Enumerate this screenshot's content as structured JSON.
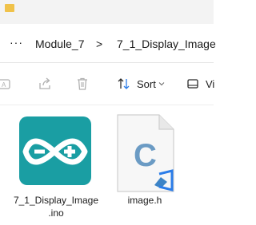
{
  "breadcrumb": {
    "overflow_label": "···",
    "segments": [
      "Module_7",
      "7_1_Display_Image"
    ],
    "separator": ">"
  },
  "toolbar": {
    "rename_icon": "rename-icon",
    "share_icon": "share-icon",
    "delete_icon": "trash-icon",
    "sort_label": "Sort",
    "view_label": "Vi"
  },
  "files": [
    {
      "name_line1": "7_1_Display_Image",
      "name_line2": ".ino",
      "icon": "arduino-icon",
      "color": "#1a9ea3"
    },
    {
      "name_line1": "image.h",
      "icon": "c-header-file-icon",
      "color": "#3d84c6"
    }
  ],
  "colors": {
    "accent": "#2b7de9",
    "arduino_teal": "#1a9ea3",
    "c_blue": "#6b9bc4"
  }
}
